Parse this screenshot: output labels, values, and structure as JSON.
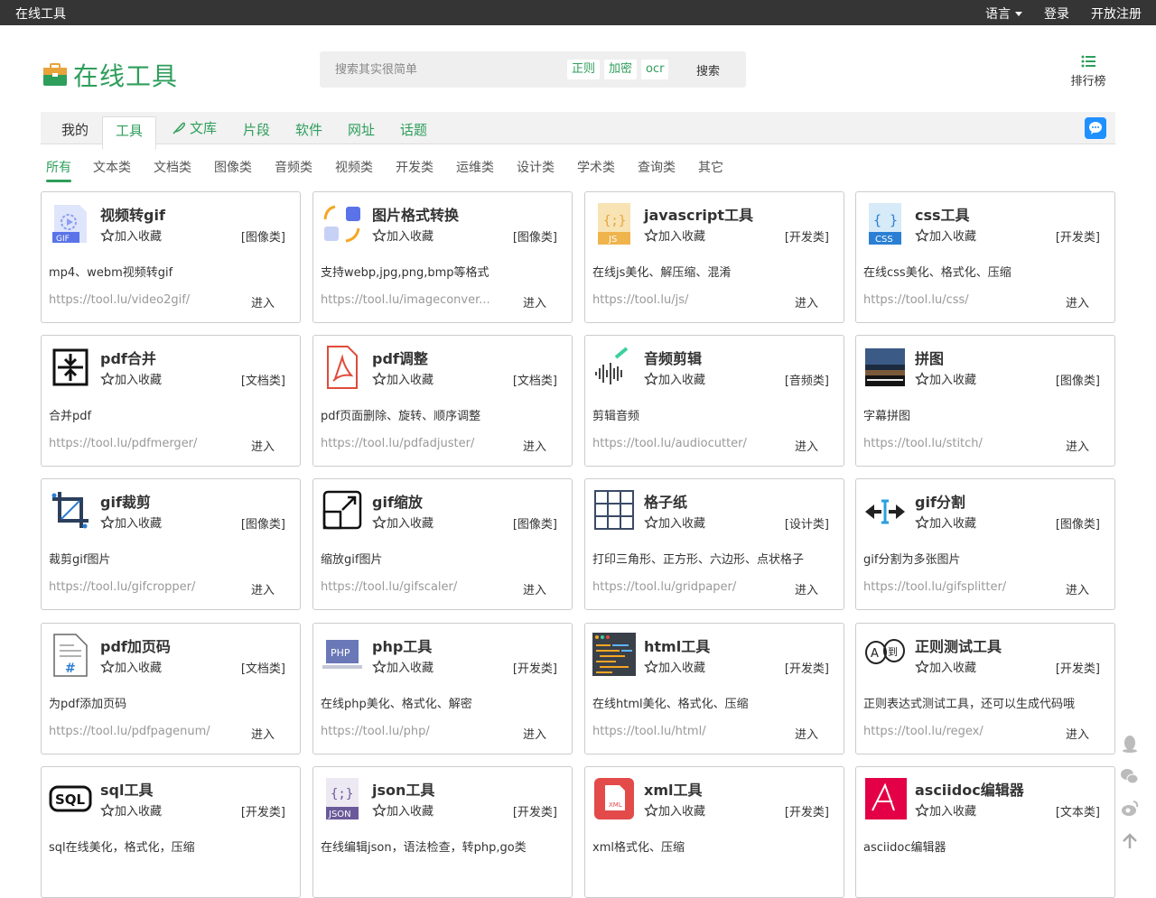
{
  "topbar": {
    "brand": "在线工具",
    "language": "语言",
    "login": "登录",
    "register": "开放注册"
  },
  "logo": {
    "text": "在线工具"
  },
  "search": {
    "placeholder": "搜索其实很简单",
    "tags": [
      "正则",
      "加密",
      "ocr"
    ],
    "button": "搜索"
  },
  "ranking": {
    "label": "排行榜"
  },
  "nav": {
    "tabs": [
      "我的",
      "工具",
      "文库",
      "片段",
      "软件",
      "网址",
      "话题"
    ],
    "active": "工具"
  },
  "categories": {
    "items": [
      "所有",
      "文本类",
      "文档类",
      "图像类",
      "音频类",
      "视频类",
      "开发类",
      "运维类",
      "设计类",
      "学术类",
      "查询类",
      "其它"
    ],
    "active": "所有"
  },
  "fav_label": "加入收藏",
  "enter_label": "进入",
  "tools": [
    {
      "title": "视频转gif",
      "cat": "[图像类]",
      "desc": "mp4、webm视频转gif",
      "url": "https://tool.lu/video2gif/",
      "icon": "video-gif-icon"
    },
    {
      "title": "图片格式转换",
      "cat": "[图像类]",
      "desc": "支持webp,jpg,png,bmp等格式",
      "url": "https://tool.lu/imageconver...",
      "icon": "image-convert-icon"
    },
    {
      "title": "javascript工具",
      "cat": "[开发类]",
      "desc": "在线js美化、解压缩、混淆",
      "url": "https://tool.lu/js/",
      "icon": "js-file-icon"
    },
    {
      "title": "css工具",
      "cat": "[开发类]",
      "desc": "在线css美化、格式化、压缩",
      "url": "https://tool.lu/css/",
      "icon": "css-file-icon"
    },
    {
      "title": "pdf合并",
      "cat": "[文档类]",
      "desc": "合并pdf",
      "url": "https://tool.lu/pdfmerger/",
      "icon": "pdf-merge-icon"
    },
    {
      "title": "pdf调整",
      "cat": "[文档类]",
      "desc": "pdf页面删除、旋转、顺序调整",
      "url": "https://tool.lu/pdfadjuster/",
      "icon": "pdf-icon"
    },
    {
      "title": "音频剪辑",
      "cat": "[音频类]",
      "desc": "剪辑音频",
      "url": "https://tool.lu/audiocutter/",
      "icon": "audio-wave-icon"
    },
    {
      "title": "拼图",
      "cat": "[图像类]",
      "desc": "字幕拼图",
      "url": "https://tool.lu/stitch/",
      "icon": "stitch-photo-icon"
    },
    {
      "title": "gif裁剪",
      "cat": "[图像类]",
      "desc": "裁剪gif图片",
      "url": "https://tool.lu/gifcropper/",
      "icon": "crop-icon"
    },
    {
      "title": "gif缩放",
      "cat": "[图像类]",
      "desc": "缩放gif图片",
      "url": "https://tool.lu/gifscaler/",
      "icon": "resize-icon"
    },
    {
      "title": "格子纸",
      "cat": "[设计类]",
      "desc": "打印三角形、正方形、六边形、点状格子",
      "url": "https://tool.lu/gridpaper/",
      "icon": "grid-icon"
    },
    {
      "title": "gif分割",
      "cat": "[图像类]",
      "desc": "gif分割为多张图片",
      "url": "https://tool.lu/gifsplitter/",
      "icon": "split-icon"
    },
    {
      "title": "pdf加页码",
      "cat": "[文档类]",
      "desc": "为pdf添加页码",
      "url": "https://tool.lu/pdfpagenum/",
      "icon": "page-number-icon"
    },
    {
      "title": "php工具",
      "cat": "[开发类]",
      "desc": "在线php美化、格式化、解密",
      "url": "https://tool.lu/php/",
      "icon": "php-icon"
    },
    {
      "title": "html工具",
      "cat": "[开发类]",
      "desc": "在线html美化、格式化、压缩",
      "url": "https://tool.lu/html/",
      "icon": "html-code-icon"
    },
    {
      "title": "正则测试工具",
      "cat": "[开发类]",
      "desc": "正则表达式测试工具，还可以生成代码哦",
      "url": "https://tool.lu/regex/",
      "icon": "regex-icon"
    },
    {
      "title": "sql工具",
      "cat": "[开发类]",
      "desc": "sql在线美化，格式化，压缩",
      "url": "",
      "icon": "sql-icon"
    },
    {
      "title": "json工具",
      "cat": "[开发类]",
      "desc": "在线编辑json，语法检查，转php,go类",
      "url": "",
      "icon": "json-file-icon"
    },
    {
      "title": "xml工具",
      "cat": "[开发类]",
      "desc": "xml格式化、压缩",
      "url": "",
      "icon": "xml-file-icon"
    },
    {
      "title": "asciidoc编辑器",
      "cat": "[文本类]",
      "desc": "asciidoc编辑器",
      "url": "",
      "icon": "asciidoc-icon"
    }
  ],
  "colors": {
    "accent": "#2e9e5b",
    "topbar": "#353535"
  }
}
